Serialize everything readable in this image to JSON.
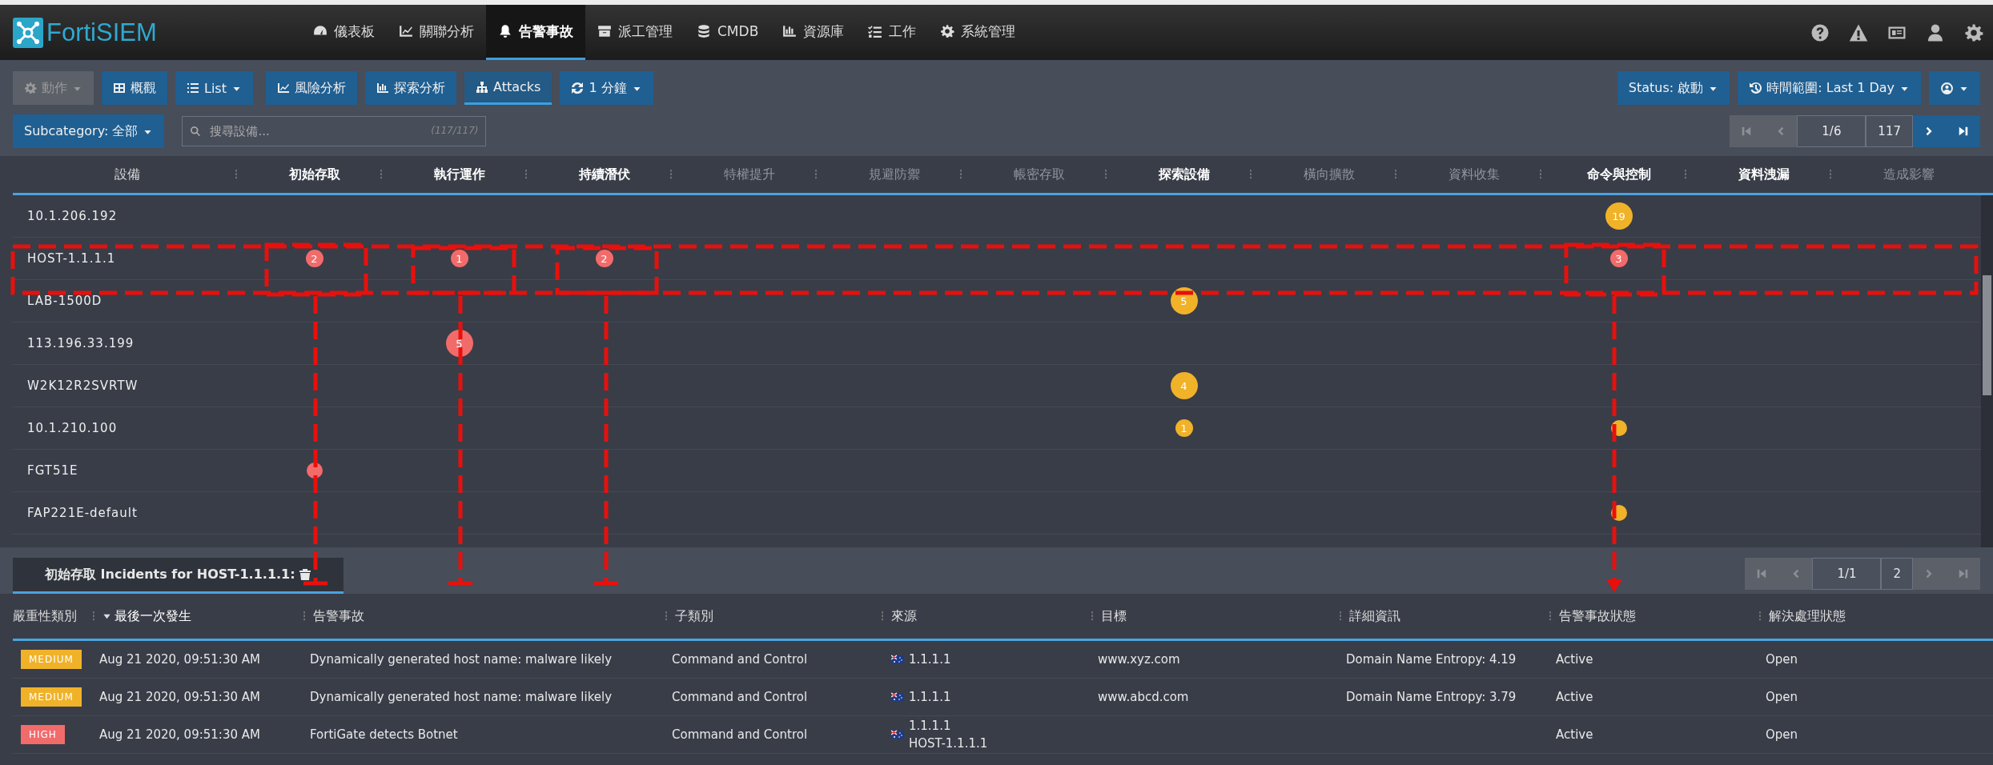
{
  "app": {
    "logo_text": "FortiSIEM"
  },
  "nav": [
    {
      "label": "儀表板",
      "selected": false
    },
    {
      "label": "關聯分析",
      "selected": false
    },
    {
      "label": "告警事故",
      "selected": true
    },
    {
      "label": "派工管理",
      "selected": false
    },
    {
      "label": "CMDB",
      "selected": false
    },
    {
      "label": "資源庫",
      "selected": false
    },
    {
      "label": "工作",
      "selected": false
    },
    {
      "label": "系統管理",
      "selected": false
    }
  ],
  "toolbar": [
    {
      "label": "動作",
      "disabled": true,
      "dropdown": true,
      "selected": false
    },
    {
      "label": "概觀",
      "disabled": false,
      "dropdown": false,
      "selected": false
    },
    {
      "label": "List",
      "disabled": false,
      "dropdown": true,
      "selected": false
    },
    {
      "label": "風險分析",
      "disabled": false,
      "dropdown": false,
      "selected": false
    },
    {
      "label": "探索分析",
      "disabled": false,
      "dropdown": false,
      "selected": false
    },
    {
      "label": "Attacks",
      "disabled": false,
      "dropdown": false,
      "selected": true
    },
    {
      "label": "1 分鐘",
      "disabled": false,
      "dropdown": true,
      "selected": false
    }
  ],
  "filters": {
    "status": "Status: 啟動",
    "time_range": "時間範圍: Last 1 Day",
    "subcategory": "Subcategory: 全部"
  },
  "search": {
    "placeholder": "搜尋設備...",
    "count": "(117/117)"
  },
  "pager": {
    "page": "1/6",
    "total": "117"
  },
  "attack_grid": {
    "columns": [
      {
        "label": "設備"
      },
      {
        "label": "初始存取",
        "active": true
      },
      {
        "label": "執行運作",
        "active": true
      },
      {
        "label": "持續潛伏",
        "active": true
      },
      {
        "label": "特權提升",
        "active": false
      },
      {
        "label": "規避防禦",
        "active": false
      },
      {
        "label": "帳密存取",
        "active": false
      },
      {
        "label": "探索設備",
        "active": true
      },
      {
        "label": "橫向擴散",
        "active": false
      },
      {
        "label": "資料收集",
        "active": false
      },
      {
        "label": "命令與控制",
        "active": true
      },
      {
        "label": "資料洩漏",
        "active": true
      },
      {
        "label": "造成影響",
        "active": false
      }
    ],
    "rows": [
      {
        "cells": [
          "10.1.206.192",
          "",
          "",
          "",
          "",
          "",
          "",
          "",
          "",
          "",
          {
            "count": "19",
            "color": "#f0b229"
          },
          "",
          ""
        ]
      },
      {
        "cells": [
          "HOST-1.1.1.1",
          {
            "count": "2",
            "color": "#f26b6b"
          },
          {
            "count": "1",
            "color": "#f26b6b"
          },
          {
            "count": "2",
            "color": "#f26b6b"
          },
          "",
          "",
          "",
          "",
          "",
          "",
          {
            "count": "3",
            "color": "#f26b6b"
          },
          "",
          ""
        ]
      },
      {
        "cells": [
          "LAB-1500D",
          "",
          "",
          "",
          "",
          "",
          "",
          {
            "count": "5",
            "color": "#f0b229"
          },
          "",
          "",
          "",
          "",
          ""
        ]
      },
      {
        "cells": [
          "113.196.33.199",
          "",
          {
            "count": "5",
            "color": "#f26b6b"
          },
          "",
          "",
          "",
          "",
          "",
          "",
          "",
          "",
          "",
          ""
        ]
      },
      {
        "cells": [
          "W2K12R2SVRTW",
          "",
          "",
          "",
          "",
          "",
          "",
          {
            "count": "4",
            "color": "#f0b229"
          },
          "",
          "",
          "",
          "",
          ""
        ]
      },
      {
        "cells": [
          "10.1.210.100",
          "",
          "",
          "",
          "",
          "",
          "",
          {
            "count": "1",
            "color": "#f0b229"
          },
          "",
          "",
          {
            "color": "#f0b229"
          },
          "",
          ""
        ]
      },
      {
        "cells": [
          "FGT51E",
          {
            "color": "#f26b6b"
          },
          "",
          "",
          "",
          "",
          "",
          "",
          "",
          "",
          "",
          "",
          ""
        ]
      },
      {
        "cells": [
          "FAP221E-default",
          "",
          "",
          "",
          "",
          "",
          "",
          "",
          "",
          "",
          {
            "color": "#f0b229"
          },
          "",
          ""
        ]
      }
    ]
  },
  "incidents": {
    "tab": "初始存取 Incidents for HOST-1.1.1.1:",
    "pager": {
      "page": "1/1",
      "total": "2"
    },
    "columns": [
      {
        "label": "嚴重性類別",
        "sorted": false
      },
      {
        "label": "最後一次發生",
        "sorted": true
      },
      {
        "label": "告警事故",
        "sorted": false
      },
      {
        "label": "子類別",
        "sorted": false
      },
      {
        "label": "來源",
        "sorted": false
      },
      {
        "label": "目標",
        "sorted": false
      },
      {
        "label": "詳細資訊",
        "sorted": false
      },
      {
        "label": "告警事故狀態",
        "sorted": false
      },
      {
        "label": "解決處理狀態",
        "sorted": false
      }
    ],
    "rows": [
      {
        "severity": "MEDIUM",
        "last_occurred": "Aug 21 2020, 09:51:30 AM",
        "incident": "Dynamically generated host name: malware likely",
        "subcategory": "Command and Control",
        "source": [
          "1.1.1.1"
        ],
        "target": "www.xyz.com",
        "details": "Domain Name Entropy: 4.19",
        "status": "Active",
        "resolution": "Open"
      },
      {
        "severity": "MEDIUM",
        "last_occurred": "Aug 21 2020, 09:51:30 AM",
        "incident": "Dynamically generated host name: malware likely",
        "subcategory": "Command and Control",
        "source": [
          "1.1.1.1"
        ],
        "target": "www.abcd.com",
        "details": "Domain Name Entropy: 3.79",
        "status": "Active",
        "resolution": "Open"
      },
      {
        "severity": "HIGH",
        "last_occurred": "Aug 21 2020, 09:51:30 AM",
        "incident": "FortiGate detects Botnet",
        "subcategory": "Command and Control",
        "source": [
          "1.1.1.1",
          "HOST-1.1.1.1"
        ],
        "status": "Active",
        "resolution": "Open"
      }
    ]
  }
}
